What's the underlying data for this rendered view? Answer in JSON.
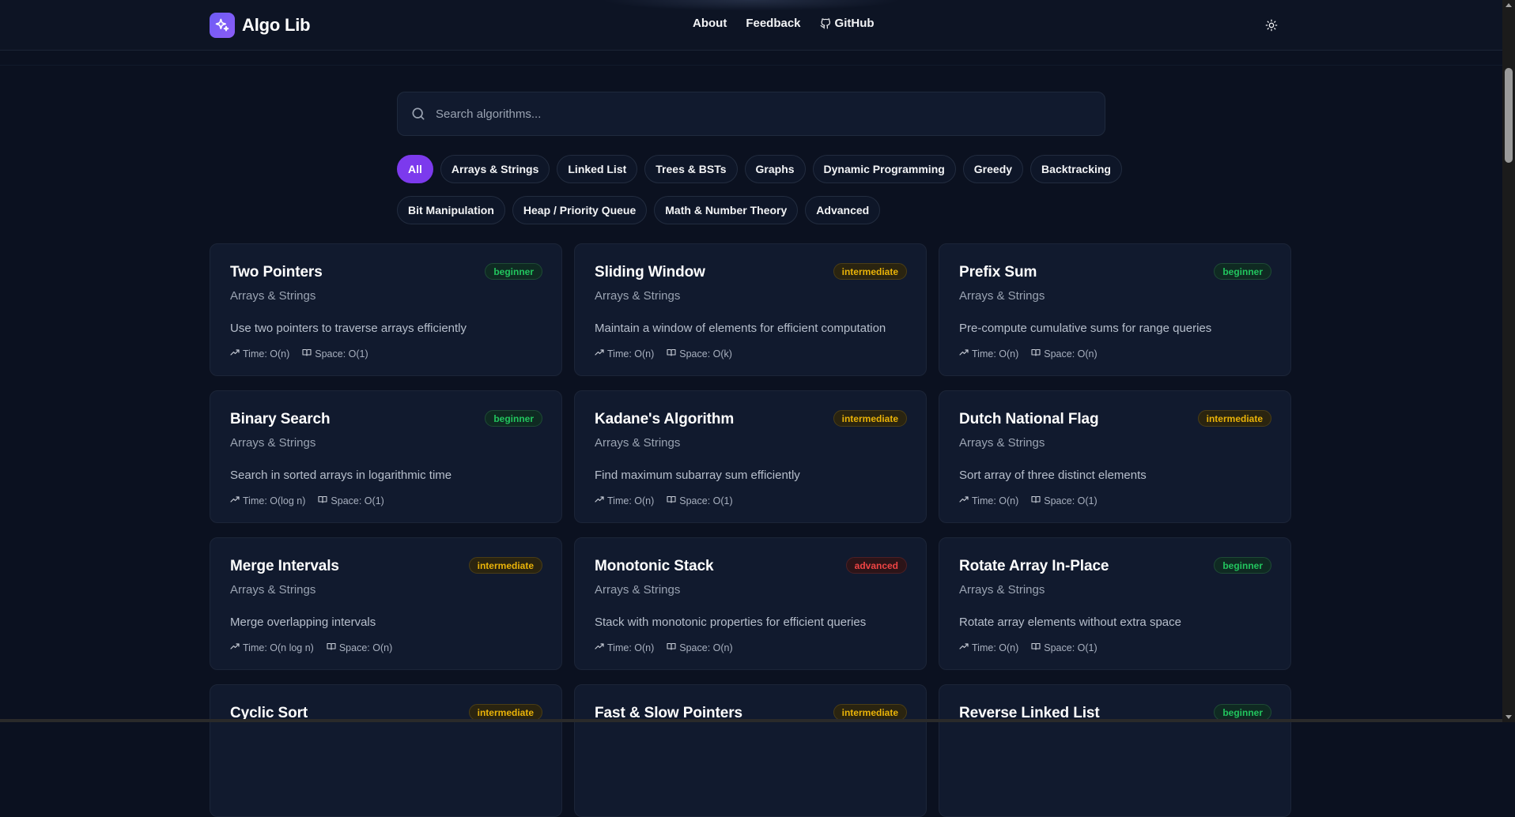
{
  "header": {
    "brand": "Algo Lib",
    "nav": [
      {
        "label": "About"
      },
      {
        "label": "Feedback"
      },
      {
        "label": "GitHub"
      }
    ]
  },
  "search": {
    "placeholder": "Search algorithms...",
    "value": ""
  },
  "filters": {
    "active": "All",
    "row1": [
      "All",
      "Arrays & Strings",
      "Linked List",
      "Trees & BSTs",
      "Graphs",
      "Dynamic Programming",
      "Greedy",
      "Backtracking"
    ],
    "row2": [
      "Bit Manipulation",
      "Heap / Priority Queue",
      "Math & Number Theory",
      "Advanced"
    ]
  },
  "colors": {
    "accent": "#7c3aed",
    "beginner": "#22c55e",
    "intermediate": "#eab308",
    "advanced": "#ef4444"
  },
  "cards": [
    {
      "title": "Two Pointers",
      "category": "Arrays & Strings",
      "level": "beginner",
      "description": "Use two pointers to traverse arrays efficiently",
      "time": "Time: O(n)",
      "space": "Space: O(1)"
    },
    {
      "title": "Sliding Window",
      "category": "Arrays & Strings",
      "level": "intermediate",
      "description": "Maintain a window of elements for efficient computation",
      "time": "Time: O(n)",
      "space": "Space: O(k)"
    },
    {
      "title": "Prefix Sum",
      "category": "Arrays & Strings",
      "level": "beginner",
      "description": "Pre-compute cumulative sums for range queries",
      "time": "Time: O(n)",
      "space": "Space: O(n)"
    },
    {
      "title": "Binary Search",
      "category": "Arrays & Strings",
      "level": "beginner",
      "description": "Search in sorted arrays in logarithmic time",
      "time": "Time: O(log n)",
      "space": "Space: O(1)"
    },
    {
      "title": "Kadane's Algorithm",
      "category": "Arrays & Strings",
      "level": "intermediate",
      "description": "Find maximum subarray sum efficiently",
      "time": "Time: O(n)",
      "space": "Space: O(1)"
    },
    {
      "title": "Dutch National Flag",
      "category": "Arrays & Strings",
      "level": "intermediate",
      "description": "Sort array of three distinct elements",
      "time": "Time: O(n)",
      "space": "Space: O(1)"
    },
    {
      "title": "Merge Intervals",
      "category": "Arrays & Strings",
      "level": "intermediate",
      "description": "Merge overlapping intervals",
      "time": "Time: O(n log n)",
      "space": "Space: O(n)"
    },
    {
      "title": "Monotonic Stack",
      "category": "Arrays & Strings",
      "level": "advanced",
      "description": "Stack with monotonic properties for efficient queries",
      "time": "Time: O(n)",
      "space": "Space: O(n)"
    },
    {
      "title": "Rotate Array In-Place",
      "category": "Arrays & Strings",
      "level": "beginner",
      "description": "Rotate array elements without extra space",
      "time": "Time: O(n)",
      "space": "Space: O(1)"
    },
    {
      "title": "Cyclic Sort",
      "category": "",
      "level": "intermediate",
      "description": "",
      "time": "",
      "space": ""
    },
    {
      "title": "Fast & Slow Pointers",
      "category": "",
      "level": "intermediate",
      "description": "",
      "time": "",
      "space": ""
    },
    {
      "title": "Reverse Linked List",
      "category": "",
      "level": "beginner",
      "description": "",
      "time": "",
      "space": ""
    }
  ]
}
